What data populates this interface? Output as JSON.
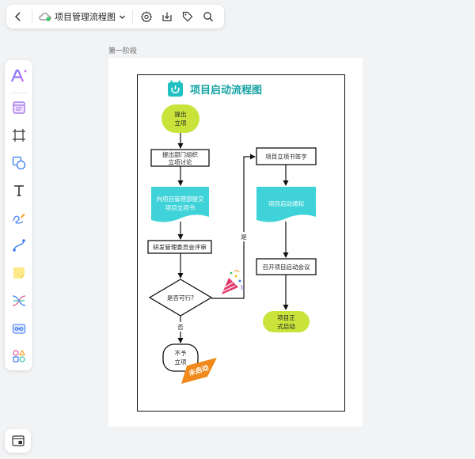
{
  "toolbar": {
    "doc_title": "项目管理流程图"
  },
  "canvas": {
    "page_label": "第一阶段"
  },
  "diagram": {
    "title": "项目启动流程图",
    "nodes": {
      "start_line1": "提出",
      "start_line2": "立项",
      "discuss_line1": "提出部门组织",
      "discuss_line2": "立项讨论",
      "submit_line1": "向项目管理部提交",
      "submit_line2": "项目立项书",
      "review": "研发管理委员会评审",
      "decision": "是否可行?",
      "reject_line1": "不予",
      "reject_line2": "立项",
      "sign": "项目立项书签字",
      "notice": "项目启动通知",
      "meeting": "召开项目启动会议",
      "end_line1": "项目正",
      "end_line2": "式启动"
    },
    "edges": {
      "yes": "是",
      "no": "否"
    },
    "stamp": "未启动"
  },
  "colors": {
    "lime": "#c9e33a",
    "teal": "#3fd3d9",
    "title_teal": "#17a2a2",
    "stamp_orange": "#f08a1c"
  }
}
